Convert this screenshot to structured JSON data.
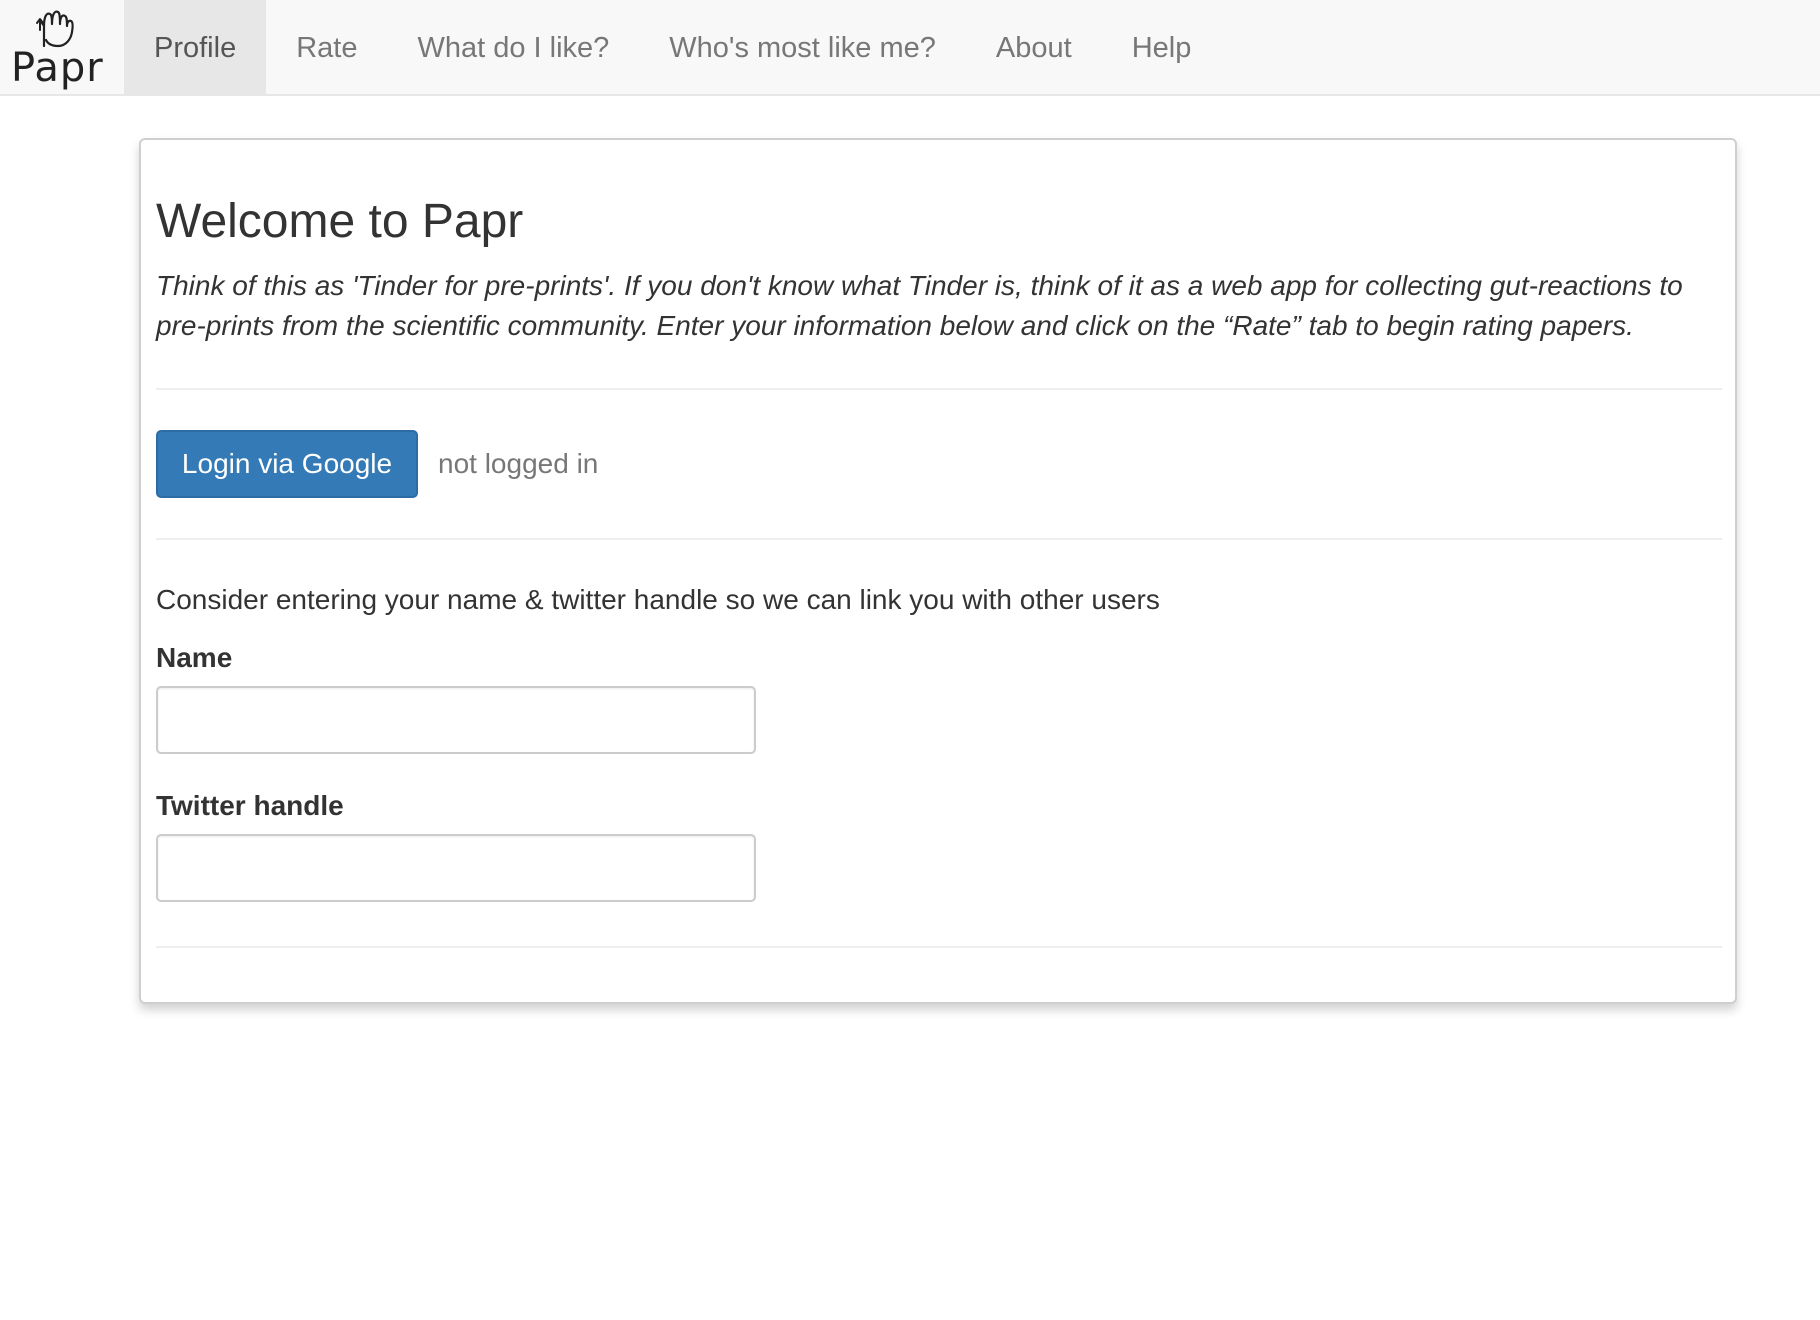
{
  "navbar": {
    "brand": {
      "text": "Papr",
      "icon": "pointing-hand-icon"
    },
    "tabs": [
      {
        "label": "Profile",
        "active": true
      },
      {
        "label": "Rate",
        "active": false
      },
      {
        "label": "What do I like?",
        "active": false
      },
      {
        "label": "Who's most like me?",
        "active": false
      },
      {
        "label": "About",
        "active": false
      },
      {
        "label": "Help",
        "active": false
      }
    ]
  },
  "main": {
    "title": "Welcome to Papr",
    "intro": "Think of this as 'Tinder for pre-prints'. If you don't know what Tinder is, think of it as a web app for collecting gut-reactions to pre-prints from the scientific community. Enter your information below and click on the “Rate” tab to begin rating papers.",
    "login_button_label": "Login via Google",
    "login_status": "not logged in",
    "hint": "Consider entering your name & twitter handle so we can link you with other users",
    "fields": {
      "name": {
        "label": "Name",
        "value": "",
        "placeholder": ""
      },
      "twitter": {
        "label": "Twitter handle",
        "value": "",
        "placeholder": ""
      }
    }
  },
  "colors": {
    "primary_button": "#337ab7",
    "navbar_bg": "#f8f8f8",
    "active_tab_bg": "#e7e7e7",
    "muted_text": "#777777"
  }
}
